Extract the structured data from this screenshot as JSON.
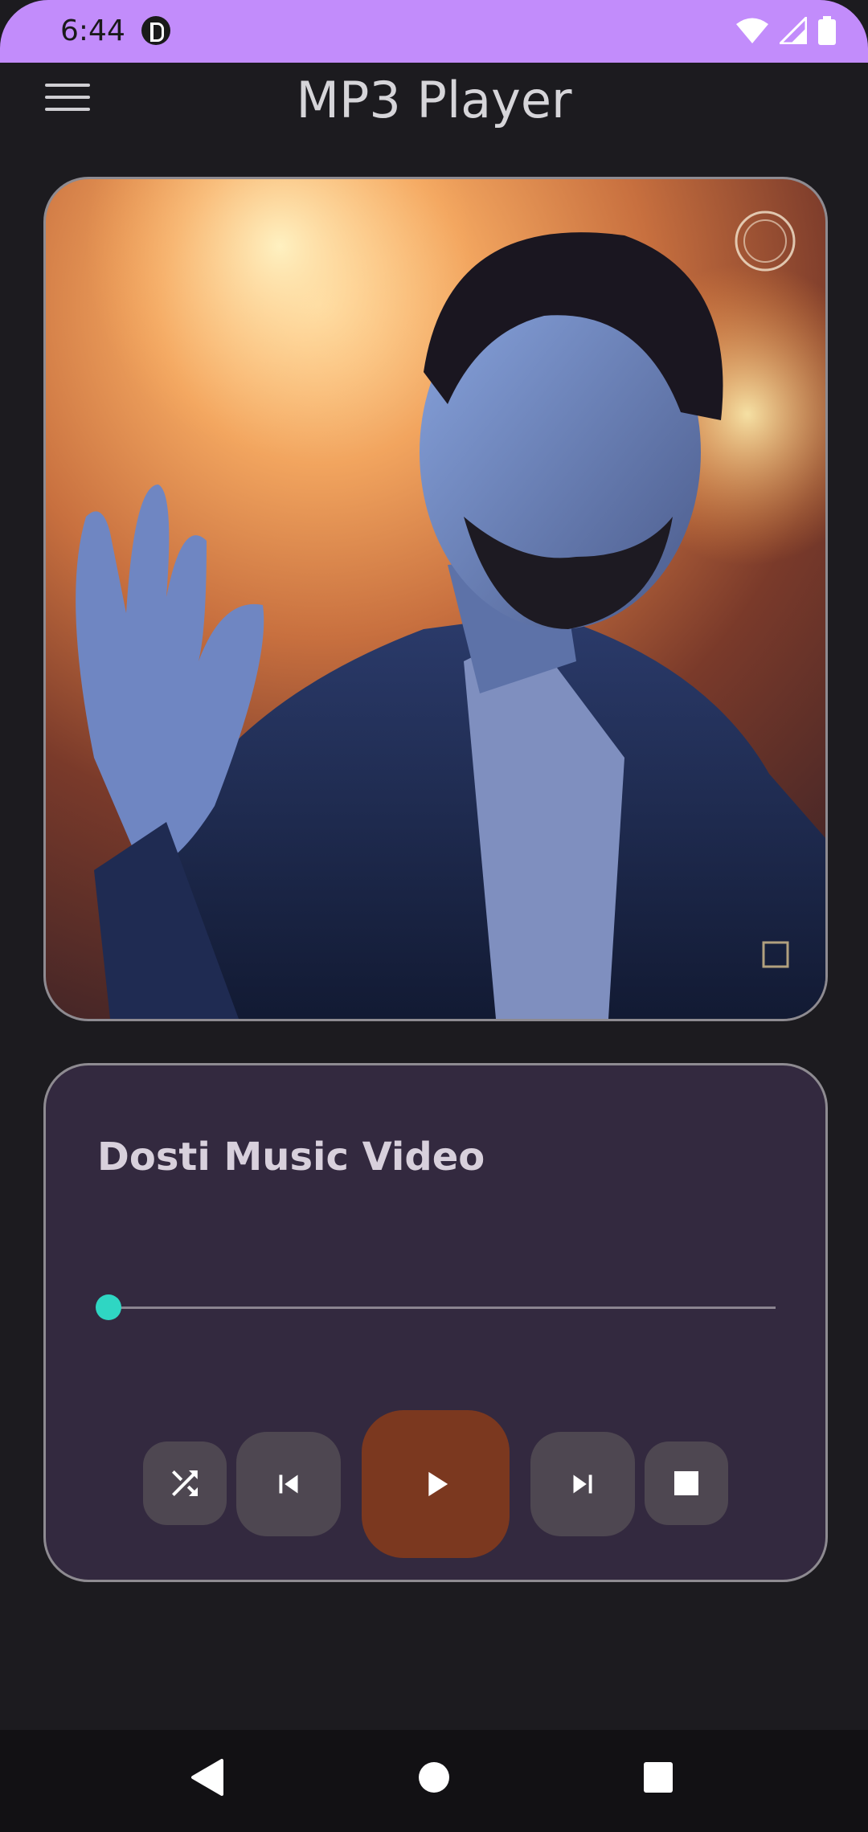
{
  "status_bar": {
    "time": "6:44",
    "icons": [
      "app-notification-icon",
      "wifi-icon",
      "signal-icon",
      "battery-icon"
    ]
  },
  "app_bar": {
    "title": "MP3 Player",
    "menu_icon": "menu-icon"
  },
  "album_art": {
    "description_icon": "album-art"
  },
  "player": {
    "song_title": "Dosti Music Video",
    "progress": 0.0,
    "controls": [
      "shuffle-icon",
      "skip-previous-icon",
      "play-icon",
      "skip-next-icon",
      "stop-icon"
    ]
  },
  "nav_bar": {
    "items": [
      "back-icon",
      "home-icon",
      "recents-icon"
    ]
  },
  "colors": {
    "status_bar": "#c28cfb",
    "background": "#1c1b1f",
    "player_card": "#33293f",
    "play_button": "#7b381f",
    "seek_thumb": "#2fd6c3",
    "control_button": "#4e4751"
  }
}
